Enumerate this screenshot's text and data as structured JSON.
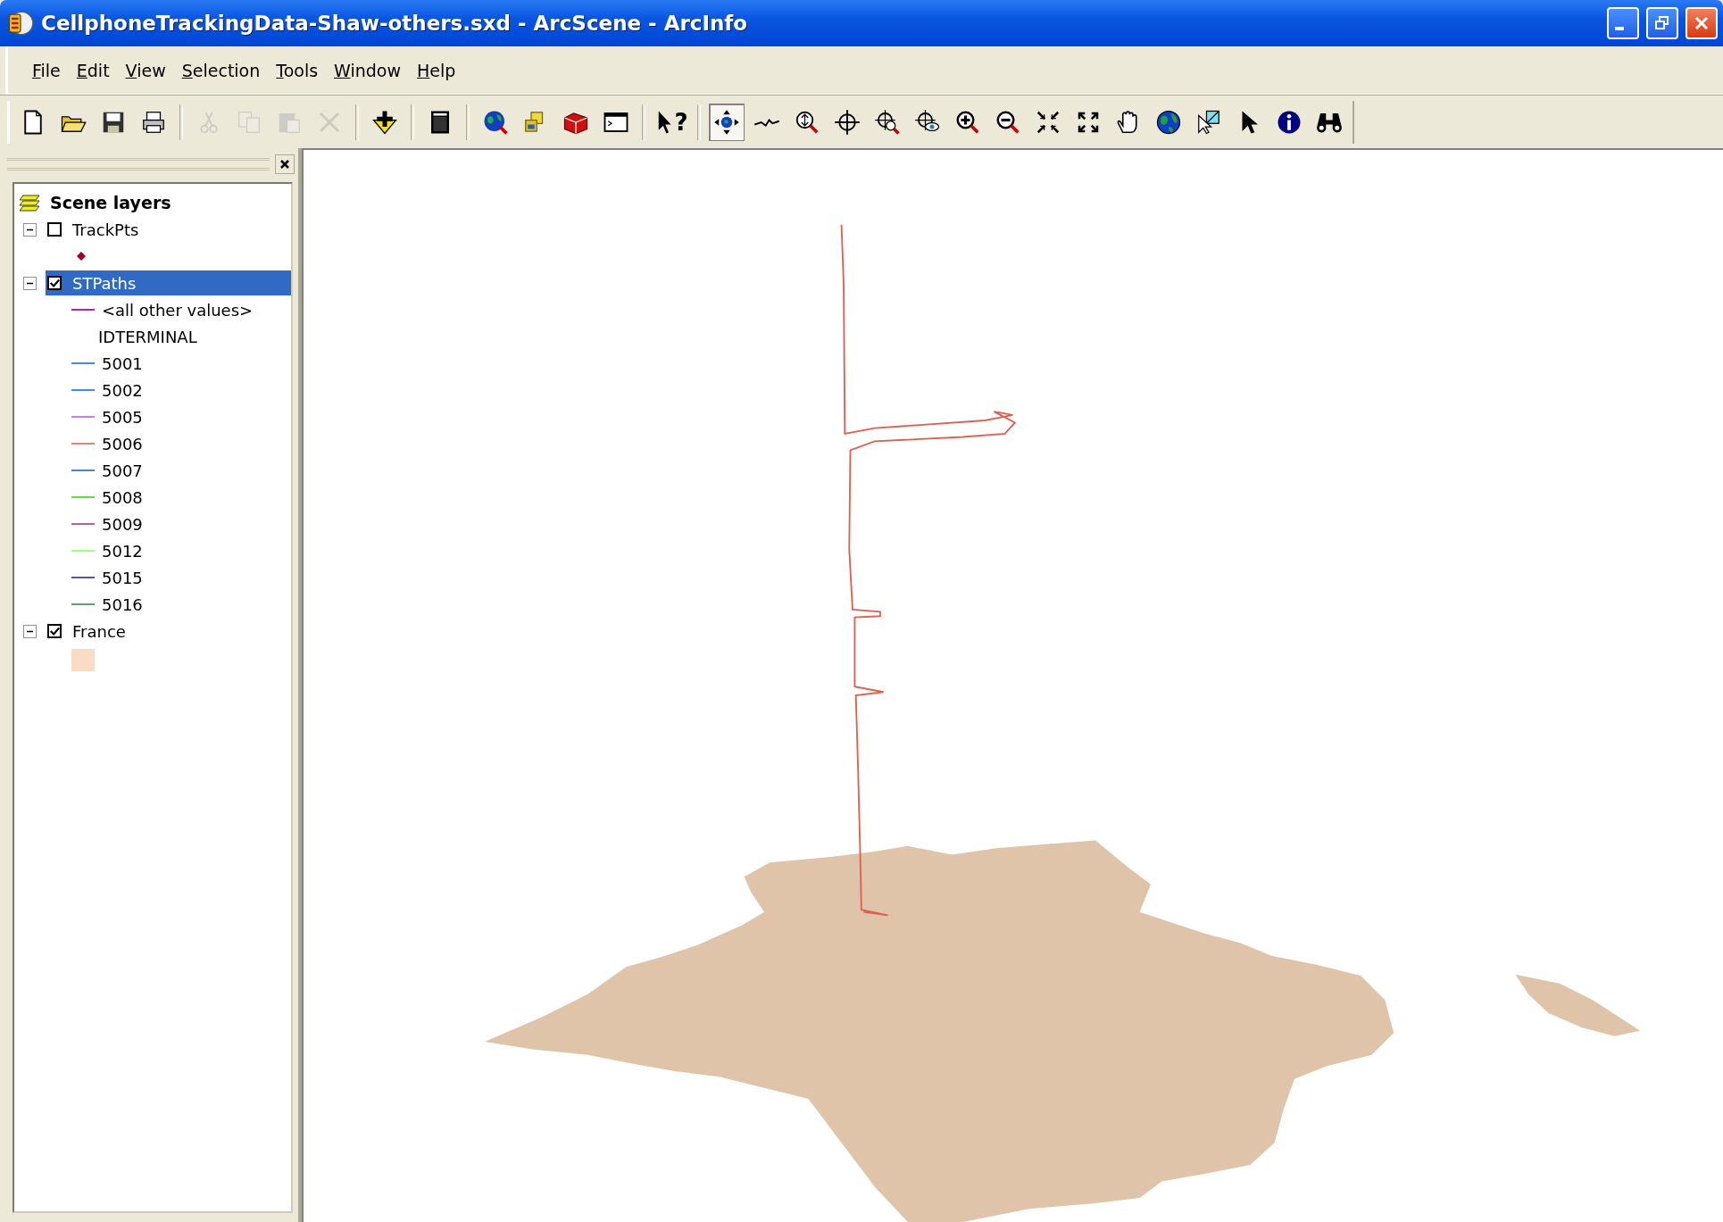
{
  "window": {
    "title": "CellphoneTrackingData-Shaw-others.sxd - ArcScene - ArcInfo"
  },
  "menu": [
    "File",
    "Edit",
    "View",
    "Selection",
    "Tools",
    "Window",
    "Help"
  ],
  "toolbar": [
    {
      "kind": "new",
      "disabled": false,
      "selected": false
    },
    {
      "kind": "open",
      "disabled": false,
      "selected": false
    },
    {
      "kind": "save",
      "disabled": false,
      "selected": false
    },
    {
      "kind": "print",
      "disabled": false,
      "selected": false
    },
    {
      "kind": "separator"
    },
    {
      "kind": "cut",
      "disabled": true,
      "selected": false
    },
    {
      "kind": "copy",
      "disabled": true,
      "selected": false
    },
    {
      "kind": "paste",
      "disabled": true,
      "selected": false
    },
    {
      "kind": "delete",
      "disabled": true,
      "selected": false
    },
    {
      "kind": "separator"
    },
    {
      "kind": "add-data",
      "disabled": false,
      "selected": false
    },
    {
      "kind": "separator"
    },
    {
      "kind": "window",
      "disabled": false,
      "selected": false
    },
    {
      "kind": "separator"
    },
    {
      "kind": "globe-search",
      "disabled": false,
      "selected": false
    },
    {
      "kind": "layers-3d",
      "disabled": false,
      "selected": false
    },
    {
      "kind": "toolbox",
      "disabled": false,
      "selected": false
    },
    {
      "kind": "command",
      "disabled": false,
      "selected": false
    },
    {
      "kind": "separator"
    },
    {
      "kind": "help",
      "glyph": "?",
      "disabled": false,
      "selected": false
    },
    {
      "kind": "separator"
    },
    {
      "kind": "navigate",
      "disabled": false,
      "selected": true
    },
    {
      "kind": "fly",
      "disabled": false,
      "selected": false
    },
    {
      "kind": "zoom-target",
      "disabled": false,
      "selected": false
    },
    {
      "kind": "center-target",
      "disabled": false,
      "selected": false
    },
    {
      "kind": "zoom-to-target",
      "disabled": false,
      "selected": false
    },
    {
      "kind": "observer",
      "disabled": false,
      "selected": false
    },
    {
      "kind": "zoom-in",
      "disabled": false,
      "selected": false
    },
    {
      "kind": "zoom-out",
      "disabled": false,
      "selected": false
    },
    {
      "kind": "fixed-in",
      "disabled": false,
      "selected": false
    },
    {
      "kind": "fixed-out",
      "disabled": false,
      "selected": false
    },
    {
      "kind": "pan",
      "disabled": false,
      "selected": false
    },
    {
      "kind": "full-extent",
      "disabled": false,
      "selected": false
    },
    {
      "kind": "select-graphics",
      "disabled": false,
      "selected": false
    },
    {
      "kind": "select",
      "disabled": false,
      "selected": false
    },
    {
      "kind": "identify",
      "disabled": false,
      "selected": false
    },
    {
      "kind": "find",
      "disabled": false,
      "selected": false
    }
  ],
  "toc": {
    "title": "Scene layers",
    "layers": [
      {
        "name": "TrackPts",
        "expanded": true,
        "checked": false,
        "selected": false,
        "legend": [
          {
            "kind": "marker",
            "color": "#a00020"
          }
        ]
      },
      {
        "name": "STPaths",
        "expanded": true,
        "checked": true,
        "selected": true,
        "legend": [
          {
            "kind": "line",
            "color": "#c0209a",
            "label": "<all other values>"
          },
          {
            "kind": "heading",
            "label": "IDTERMINAL"
          },
          {
            "kind": "line",
            "color": "#3c8cff",
            "label": "5001"
          },
          {
            "kind": "line",
            "color": "#3c8cff",
            "label": "5002"
          },
          {
            "kind": "line",
            "color": "#c880f0",
            "label": "5005"
          },
          {
            "kind": "line",
            "color": "#f08070",
            "label": "5006"
          },
          {
            "kind": "line",
            "color": "#5080c0",
            "label": "5007"
          },
          {
            "kind": "line",
            "color": "#60e040",
            "label": "5008"
          },
          {
            "kind": "line",
            "color": "#c06090",
            "label": "5009"
          },
          {
            "kind": "line",
            "color": "#a0ff80",
            "label": "5012"
          },
          {
            "kind": "line",
            "color": "#6050a0",
            "label": "5015"
          },
          {
            "kind": "line",
            "color": "#60a070",
            "label": "5016"
          }
        ]
      },
      {
        "name": "France",
        "expanded": true,
        "checked": true,
        "selected": false,
        "legend": [
          {
            "kind": "fill",
            "color": "#fadcc4"
          }
        ]
      }
    ]
  }
}
